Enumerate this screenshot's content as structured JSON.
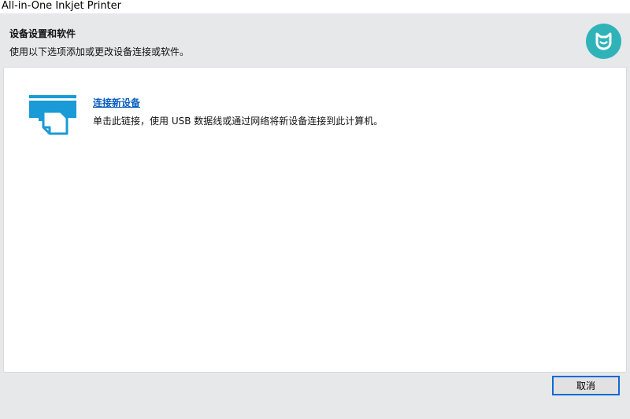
{
  "window": {
    "title": "All-in-One Inkjet Printer"
  },
  "header": {
    "heading": "设备设置和软件",
    "subheading": "使用以下选项添加或更改设备连接或软件。",
    "logo_icon": "mi-brand-logo",
    "logo_color": "#2fb3b8"
  },
  "options": [
    {
      "icon": "printer-icon",
      "icon_color": "#1a9ad6",
      "link_label": "连接新设备",
      "description": "单击此链接，使用 USB 数据线或通过网络将新设备连接到此计算机。"
    }
  ],
  "footer": {
    "cancel_label": "取消"
  },
  "colors": {
    "link": "#0a5fbf",
    "shell_background": "#e6e8ea",
    "focus_border": "#0e6ad6"
  }
}
